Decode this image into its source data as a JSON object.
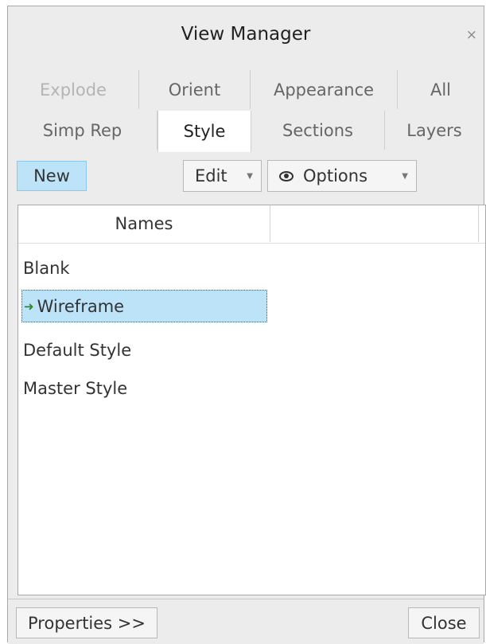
{
  "window": {
    "title": "View Manager",
    "close_glyph": "×"
  },
  "tabs_row1": [
    {
      "label": "Explode",
      "state": "disabled"
    },
    {
      "label": "Orient",
      "state": "normal"
    },
    {
      "label": "Appearance",
      "state": "normal"
    },
    {
      "label": "All",
      "state": "normal"
    }
  ],
  "tabs_row2": [
    {
      "label": "Simp Rep",
      "state": "normal"
    },
    {
      "label": "Style",
      "state": "active"
    },
    {
      "label": "Sections",
      "state": "normal"
    },
    {
      "label": "Layers",
      "state": "normal"
    }
  ],
  "toolbar": {
    "new_label": "New",
    "edit_label": "Edit",
    "options_label": "Options",
    "options_icon": "eye-icon"
  },
  "list": {
    "column_header": "Names",
    "items": [
      {
        "label": "Blank",
        "selected": false,
        "active": false
      },
      {
        "label": "Wireframe",
        "selected": true,
        "active": true
      },
      {
        "label": "Default Style",
        "selected": false,
        "active": false
      },
      {
        "label": "Master Style",
        "selected": false,
        "active": false
      }
    ]
  },
  "footer": {
    "properties_label": "Properties >>",
    "close_label": "Close"
  },
  "colors": {
    "accent": "#bde3f8",
    "active_arrow": "#2a8a2a",
    "dialog_bg": "#ececec"
  }
}
